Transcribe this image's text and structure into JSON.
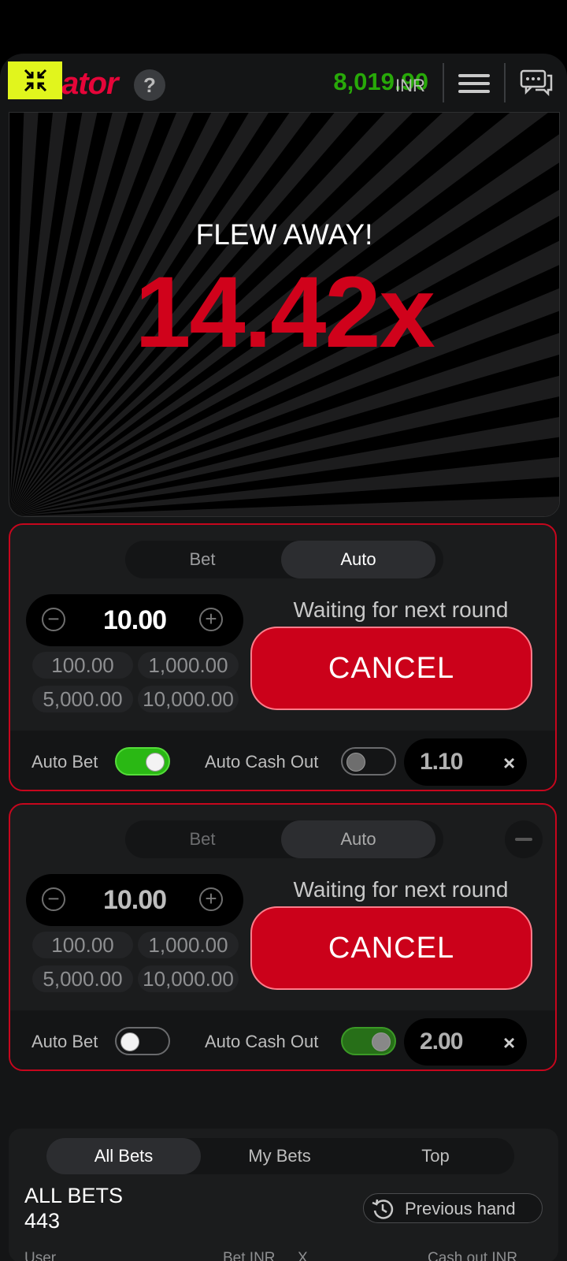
{
  "header": {
    "logo_text": "ator",
    "help_label": "?",
    "balance": "8,019.90",
    "currency": "INR"
  },
  "stage": {
    "status_text": "FLEW AWAY!",
    "multiplier": "14.42x"
  },
  "panels": [
    {
      "tabs": [
        "Bet",
        "Auto"
      ],
      "active_tab": "Auto",
      "amount": "10.00",
      "decrement_label": "−",
      "increment_label": "+",
      "quick_amounts": [
        "100.00",
        "1,000.00",
        "5,000.00",
        "10,000.00"
      ],
      "waiting_text": "Waiting for next round",
      "cancel_label": "CANCEL",
      "auto_bet_label": "Auto Bet",
      "auto_bet_on": true,
      "auto_cashout_label": "Auto Cash Out",
      "auto_cashout_on": false,
      "cashout_value": "1.10",
      "clear_label": "×"
    },
    {
      "tabs": [
        "Bet",
        "Auto"
      ],
      "active_tab": "Auto",
      "amount": "10.00",
      "decrement_label": "−",
      "increment_label": "+",
      "quick_amounts": [
        "100.00",
        "1,000.00",
        "5,000.00",
        "10,000.00"
      ],
      "waiting_text": "Waiting for next round",
      "cancel_label": "CANCEL",
      "auto_bet_label": "Auto Bet",
      "auto_bet_on": false,
      "auto_cashout_label": "Auto Cash Out",
      "auto_cashout_on": true,
      "cashout_value": "2.00",
      "clear_label": "×"
    }
  ],
  "bets": {
    "tabs": [
      "All Bets",
      "My Bets",
      "Top"
    ],
    "active_tab": "All Bets",
    "title": "ALL BETS",
    "count": "443",
    "previous_hand_label": "Previous hand",
    "columns": [
      "User",
      "Bet INR",
      "X",
      "Cash out INR"
    ]
  },
  "colors": {
    "accent_red": "#cb011a",
    "balance_green": "#28a909",
    "collapse_yellow": "#e1f51d"
  }
}
